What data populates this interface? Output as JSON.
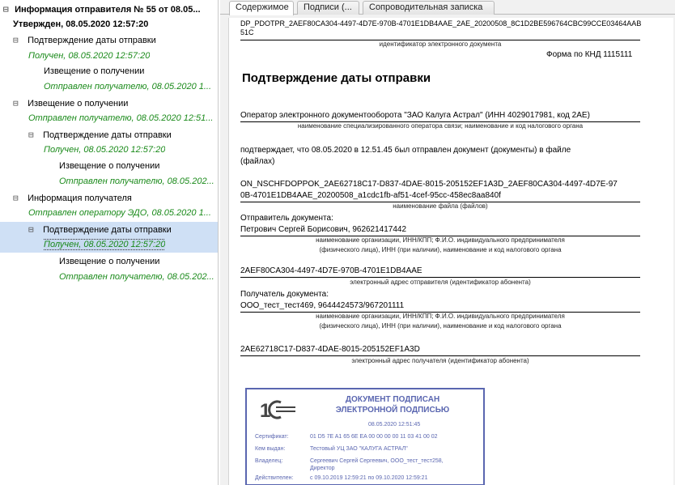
{
  "tree": {
    "root_title": "Информация отправителя № 55 от 08.05...",
    "root_status": "Утвержден, 08.05.2020 12:57:20",
    "items": [
      {
        "label": "Подтверждение даты отправки",
        "expander": "⊟"
      },
      {
        "label": "Получен, 08.05.2020 12:57:20"
      },
      {
        "label": "Извещение о получении"
      },
      {
        "label": "Отправлен получателю, 08.05.2020 1..."
      },
      {
        "label": "Извещение о получении",
        "expander": "⊟"
      },
      {
        "label": "Отправлен получателю, 08.05.2020 12:51..."
      },
      {
        "label": "Подтверждение даты отправки",
        "expander": "⊟"
      },
      {
        "label": "Получен, 08.05.2020 12:57:20"
      },
      {
        "label": "Извещение о получении"
      },
      {
        "label": "Отправлен получателю, 08.05.202..."
      },
      {
        "label": "Информация получателя",
        "expander": "⊟"
      },
      {
        "label": "Отправлен оператору ЭДО, 08.05.2020 1..."
      },
      {
        "label": "Подтверждение даты отправки",
        "expander": "⊟"
      },
      {
        "label": "Получен, 08.05.2020 12:57:20"
      },
      {
        "label": "Извещение о получении"
      },
      {
        "label": "Отправлен получателю, 08.05.202..."
      }
    ]
  },
  "tabs": [
    {
      "label": "Содержимое"
    },
    {
      "label": "Подписи (..."
    },
    {
      "label": "Сопроводительная записка"
    }
  ],
  "doc": {
    "file_id": "DP_PDOTPR_2AEF80CA304-4497-4D7E-970B-4701E1DB4AAE_2AE_20200508_8C1D2BE596764CBC99CCE03464AAB51C",
    "file_id_caption": "идентификатор электронного документа",
    "form": "Форма по КНД 1115111",
    "title": "Подтверждение даты отправки",
    "operator": "Оператор электронного документооборота \"ЗАО Калуга Астрал\" (ИНН 4029017981, код 2AE)",
    "operator_caption": "наименование специализированного оператора связи; наименование и код налогового органа",
    "confirm": "подтверждает, что 08.05.2020 в 12.51.45 был отправлен документ  (документы) в файле",
    "confirm2": "(файлах)",
    "filename1": "ON_NSCHFDOPPOK_2AE62718C17-D837-4DAE-8015-205152EF1A3D_2AEF80CA304-4497-4D7E-97",
    "filename2": "0B-4701E1DB4AAE_20200508_a1cdc1fb-af51-4cef-95cc-458ec8aa840f",
    "filename_caption": "наименование файла (файлов)",
    "sender_label": "Отправитель документа:",
    "sender": "Петрович Сергей Борисович, 962621417442",
    "sender_caption1": "наименование организации, ИНН/КПП; Ф.И.О. индивидуального предпринимателя",
    "sender_caption2": "(физического лица), ИНН (при наличии), наименование и код налогового органа",
    "sender_addr": "2AEF80CA304-4497-4D7E-970B-4701E1DB4AAE",
    "sender_addr_caption": "электронный адрес отправителя (идентификатор абонента)",
    "receiver_label": "Получатель документа:",
    "receiver": "ООО_тест_тест469, 9644424573/967201111",
    "receiver_caption1": "наименование организации, ИНН/КПП; Ф.И.О. индивидуального предпринимателя",
    "receiver_caption2": "(физического лица), ИНН (при наличии), наименование и код налогового органа",
    "receiver_addr": "2AE62718C17-D837-4DAE-8015-205152EF1A3D",
    "receiver_addr_caption": "электронный адрес получателя (идентификатор абонента)"
  },
  "stamp": {
    "title1": "ДОКУМЕНТ ПОДПИСАН",
    "title2": "ЭЛЕКТРОННОЙ ПОДПИСЬЮ",
    "date": "08.05.2020 12:51:45",
    "cert_label": "Сертификат:",
    "cert_value": "01 D5 7E A1 65 6E EA 00 00 00 00 11 03 41 00 02",
    "issuer_label": "Кем выдан:",
    "issuer_value": "Тестовый УЦ ЗАО \"КАЛУГА АСТРАЛ\"",
    "owner_label": "Владелец:",
    "owner_value1": "Сергеевич Сергей Сергеевич, ООО_тест_тест258,",
    "owner_value2": "Директор",
    "valid_label": "Действителен:",
    "valid_value": "с 09.10.2019 12:59:21 по 09.10.2020 12:59:21",
    "color": "#5a66b0"
  }
}
